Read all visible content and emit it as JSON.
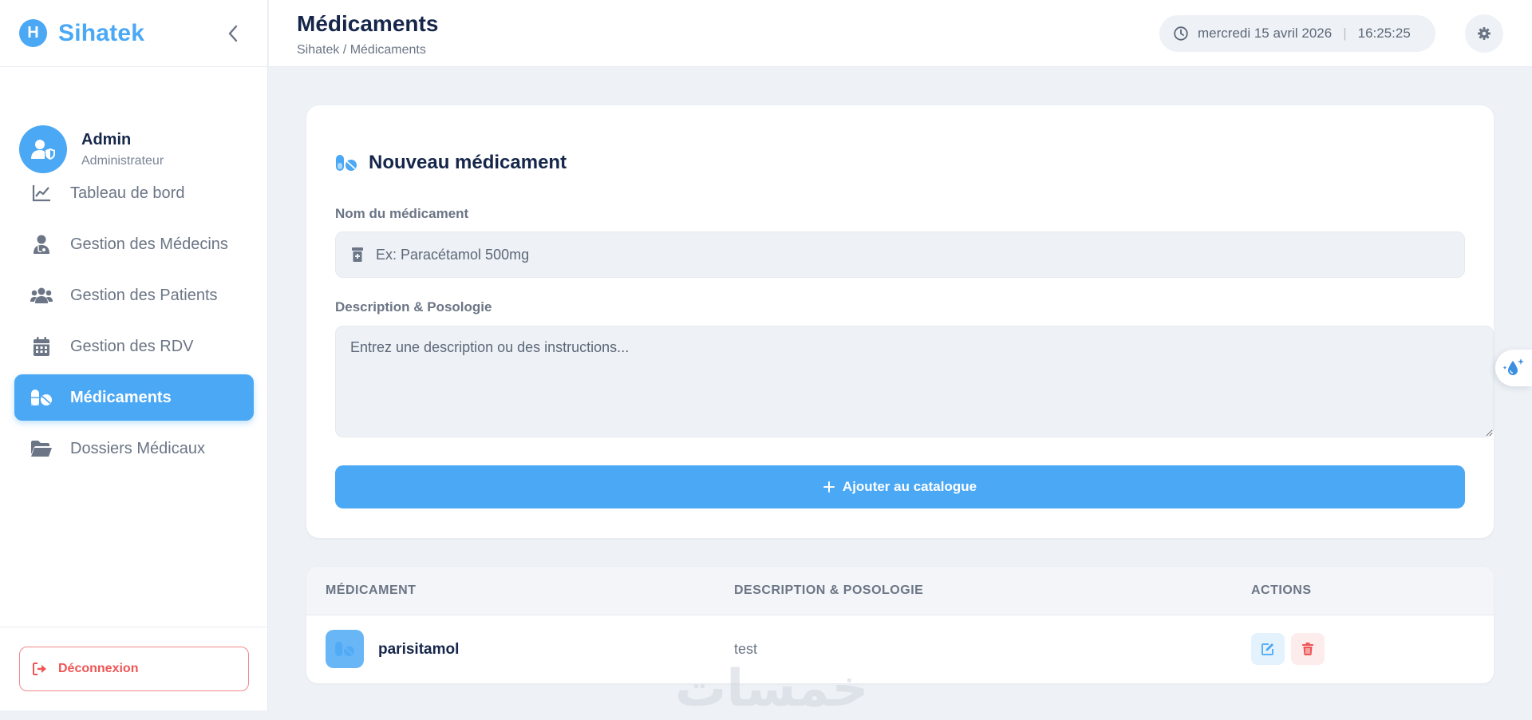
{
  "brand": {
    "logo_letter": "H",
    "name": "Sihatek"
  },
  "user": {
    "name": "Admin",
    "role": "Administrateur"
  },
  "nav": {
    "items": [
      {
        "label": "Tableau de bord",
        "icon": "chart-line-icon"
      },
      {
        "label": "Gestion des Médecins",
        "icon": "user-doctor-icon"
      },
      {
        "label": "Gestion des Patients",
        "icon": "users-icon"
      },
      {
        "label": "Gestion des RDV",
        "icon": "calendar-icon"
      },
      {
        "label": "Médicaments",
        "icon": "pills-icon",
        "active": true
      },
      {
        "label": "Dossiers Médicaux",
        "icon": "folder-open-icon"
      }
    ]
  },
  "logout": {
    "label": "Déconnexion"
  },
  "header": {
    "title": "Médicaments",
    "breadcrumb": "Sihatek / Médicaments",
    "date": "mercredi 15 avril 2026",
    "time": "16:25:25"
  },
  "form": {
    "title": "Nouveau médicament",
    "name_label": "Nom du médicament",
    "name_placeholder": "Ex: Paracétamol 500mg",
    "desc_label": "Description & Posologie",
    "desc_placeholder": "Entrez une description ou des instructions...",
    "submit_label": "Ajouter au catalogue"
  },
  "table": {
    "columns": [
      "MÉDICAMENT",
      "DESCRIPTION & POSOLOGIE",
      "ACTIONS"
    ],
    "rows": [
      {
        "name": "parisitamol",
        "description": "test"
      }
    ]
  },
  "watermark": "خمسات",
  "colors": {
    "accent": "#4aa8f5",
    "danger": "#ee5656",
    "background": "#eef2f6",
    "text_dark": "#16264a"
  }
}
